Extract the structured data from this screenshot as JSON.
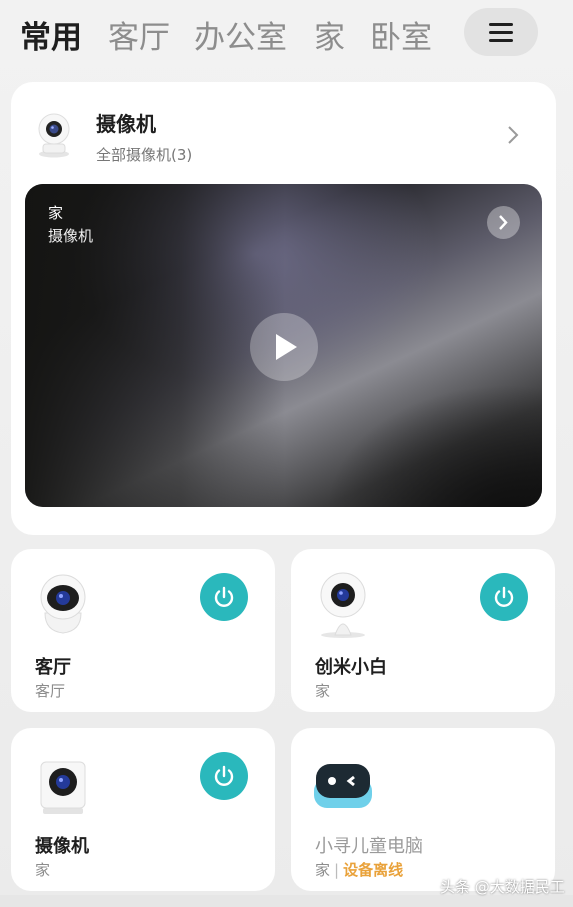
{
  "tabs": [
    {
      "label": "常用",
      "active": true
    },
    {
      "label": "客厅",
      "active": false
    },
    {
      "label": "办公室",
      "active": false
    },
    {
      "label": "家",
      "active": false
    },
    {
      "label": "卧室",
      "active": false
    }
  ],
  "menu_icon": "hamburger-menu-icon",
  "camera_card": {
    "title": "摄像机",
    "subtitle": "全部摄像机(3)",
    "video": {
      "room": "家",
      "name": "摄像机"
    }
  },
  "devices": [
    {
      "name": "客厅",
      "room": "客厅",
      "icon": "dome-camera-icon",
      "power": true
    },
    {
      "name": "创米小白",
      "room": "家",
      "icon": "stand-camera-icon",
      "power": true
    },
    {
      "name": "摄像机",
      "room": "家",
      "icon": "square-camera-icon",
      "power": true
    },
    {
      "name": "小寻儿童电脑",
      "room": "家",
      "status_sep": "|",
      "status": "设备离线",
      "icon": "kids-computer-icon",
      "power": false
    }
  ],
  "colors": {
    "accent": "#2ab8bc",
    "offline": "#e9a23b",
    "active_tab": "#1f1f1f",
    "inactive_tab": "#8d8d8d"
  },
  "watermark": "头条 @大数据民工"
}
